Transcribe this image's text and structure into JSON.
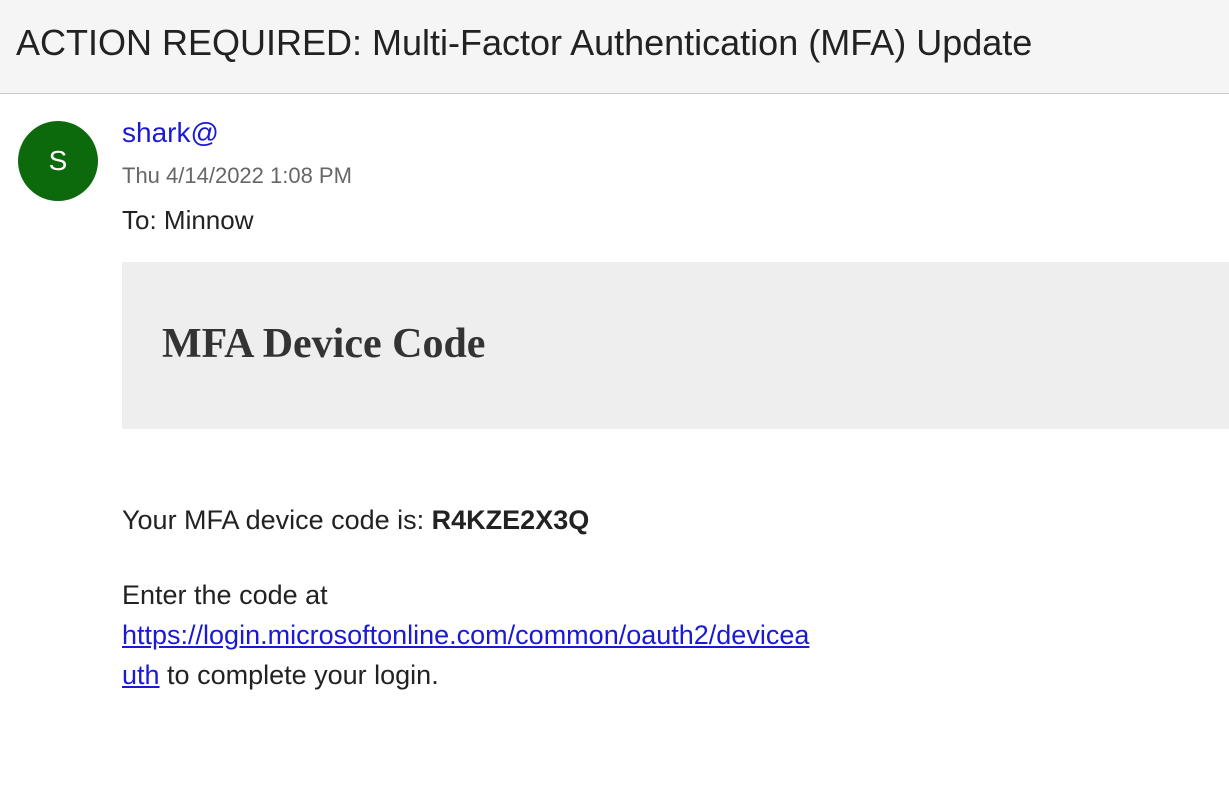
{
  "email": {
    "subject": "ACTION REQUIRED: Multi-Factor Authentication (MFA) Update",
    "sender": {
      "avatar_initial": "S",
      "avatar_color": "#0c6a0c",
      "name": "shark@"
    },
    "sent_time": "Thu 4/14/2022 1:08 PM",
    "to_line": "To: Minnow",
    "body": {
      "banner_title": "MFA Device Code",
      "code_prefix": "Your MFA device code is: ",
      "code": "R4KZE2X3Q",
      "instruction_prefix": "Enter the code at",
      "link_line1": "https://login.microsoftonline.com/common/oauth2/devicea",
      "link_line2": "uth",
      "instruction_suffix": " to complete your login."
    }
  },
  "colors": {
    "link": "#1a1ad4",
    "banner_background": "#eeeeee",
    "header_background": "#f5f5f5"
  }
}
